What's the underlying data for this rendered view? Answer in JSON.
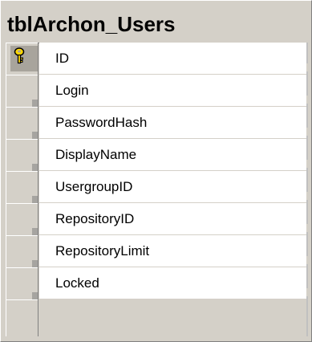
{
  "window": {
    "title": "tblArchon_Users"
  },
  "columns": [
    {
      "name": "ID",
      "primary_key": true,
      "key_icon": "key-icon"
    },
    {
      "name": "Login",
      "primary_key": false
    },
    {
      "name": "PasswordHash",
      "primary_key": false
    },
    {
      "name": "DisplayName",
      "primary_key": false
    },
    {
      "name": "UsergroupID",
      "primary_key": false
    },
    {
      "name": "RepositoryID",
      "primary_key": false
    },
    {
      "name": "RepositoryLimit",
      "primary_key": false
    },
    {
      "name": "Locked",
      "primary_key": false
    }
  ],
  "colors": {
    "frame": "#d4d0c8",
    "cell": "#ffffff",
    "key_yellow": "#ffd800"
  }
}
